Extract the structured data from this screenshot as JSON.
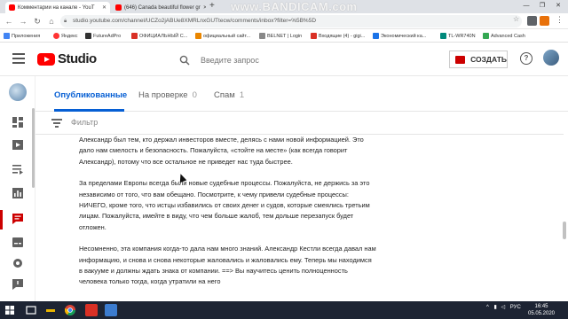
{
  "browser": {
    "tabs": [
      {
        "title": "Комментарии на канале - YouT",
        "active": true
      },
      {
        "title": "(646) Canada beautiful flower gr",
        "active": false
      }
    ],
    "new_tab": "+",
    "watermark": "www.BANDICAM.com",
    "url": "studio.youtube.com/channel/UCZo2jABUe8XMRLnxGUTtecw/comments/inbox?filter=%5B%5D",
    "bookmarks": [
      {
        "label": "Приложения",
        "color": "#4285f4"
      },
      {
        "label": "Яндекс",
        "color": "#ff3333"
      },
      {
        "label": "FutureAdPro",
        "color": "#333333"
      },
      {
        "label": "ОФИЦИАЛЬНЫЙ С...",
        "color": "#d93025"
      },
      {
        "label": "официальный сайт...",
        "color": "#ea8600"
      },
      {
        "label": "BELNET | Login",
        "color": "#888888"
      },
      {
        "label": "Входящие (4) - gigi...",
        "color": "#d93025"
      },
      {
        "label": "Экономический ка...",
        "color": "#1a73e8"
      },
      {
        "label": "TL-WR740N",
        "color": "#00897b"
      },
      {
        "label": "Advanced Cash",
        "color": "#34a853"
      }
    ]
  },
  "studio": {
    "logo_text": "Studio",
    "search_placeholder": "Введите запрос",
    "create_label": "СОЗДАТЬ",
    "help_label": "?"
  },
  "tabs": [
    {
      "label": "Опубликованные",
      "count": ""
    },
    {
      "label": "На проверке",
      "count": "0"
    },
    {
      "label": "Спам",
      "count": "1"
    }
  ],
  "filter_label": "Фильтр",
  "comment_paragraphs": [
    "Александр был тем, кто держал инвесторов вместе, делясь с нами новой информацией. Это дало нам смелость и безопасность. Пожалуйста, «стойте на месте» (как всегда говорит Александр), потому что все остальное не приведет нас туда быстрее.",
    "За пределами Европы всегда были новые судебные процессы. Пожалуйста, не держись за это независимо от того, что вам обещано. Посмотрите, к чему привели судебные процессы: НИЧЕГО, кроме того, что истцы избавились от своих денег и судов, которые смеялись третьим лицам. Пожалуйста, имейте в виду, что чем больше жалоб, тем дольше перезапуск будет отложен.",
    "Несомненно, эта компания когда-то дала нам много знаний. Александр Кестли всегда давал нам информацию, и снова и снова некоторые жаловались и жаловались ему. Теперь мы находимся в вакууме и должны ждать знака от компании. ==> Вы научитесь ценить полноценность человека только тогда, когда утратили на него"
  ],
  "taskbar": {
    "lang": "РУС",
    "time": "16:45",
    "date": "05.05.2020"
  },
  "colors": {
    "accent": "#065fd4",
    "brand": "#ff0000",
    "active_rail": "#cc0000"
  }
}
